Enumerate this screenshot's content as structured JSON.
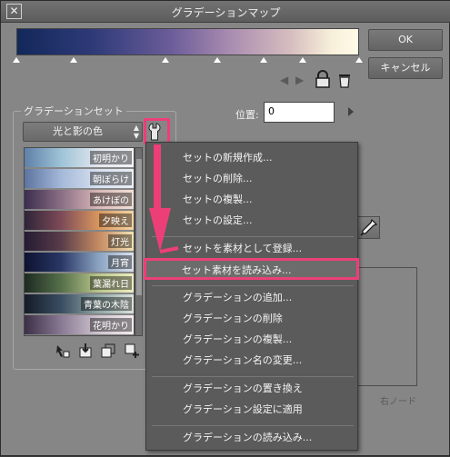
{
  "dialog": {
    "title": "グラデーションマップ",
    "close_label": "✕"
  },
  "buttons": {
    "ok": "OK",
    "cancel": "キャンセル"
  },
  "gradient_set": {
    "group_label": "グラデーションセット",
    "selected": "光と影の色",
    "items": [
      {
        "label": "初明かり",
        "colors": [
          "#5f80a8",
          "#9fc4d8",
          "#e2e6ee",
          "#f4f4f8"
        ]
      },
      {
        "label": "朝ぼらけ",
        "colors": [
          "#5c74a0",
          "#a5b9da",
          "#d6e0ee",
          "#ecf0f6"
        ]
      },
      {
        "label": "あけぼの",
        "colors": [
          "#3b2e4e",
          "#8b6f86",
          "#d9b7b7",
          "#f2e2d8"
        ]
      },
      {
        "label": "夕映え",
        "colors": [
          "#2e2438",
          "#7e4b58",
          "#d8965e",
          "#f6d8a8"
        ]
      },
      {
        "label": "灯光",
        "colors": [
          "#241a33",
          "#5a3d4a",
          "#c48a62",
          "#f6e6b8"
        ]
      },
      {
        "label": "月宵",
        "colors": [
          "#0d1230",
          "#2a3866",
          "#8aa2c0",
          "#dfe6f0"
        ]
      },
      {
        "label": "葉漏れ日",
        "colors": [
          "#1d2a22",
          "#56704a",
          "#b8c58a",
          "#f1f0c6"
        ]
      },
      {
        "label": "青葉の木陰",
        "colors": [
          "#141b26",
          "#3a4e62",
          "#8fa6a6",
          "#dfe6df"
        ]
      },
      {
        "label": "花明かり",
        "colors": [
          "#3b2f45",
          "#8a7a94",
          "#cfc4cf",
          "#f5eef2"
        ]
      }
    ]
  },
  "position": {
    "label": "位置:",
    "value": "0"
  },
  "right_node_label": "右ノード",
  "context_menu": {
    "items": [
      {
        "label": "セットの新規作成..."
      },
      {
        "label": "セットの削除..."
      },
      {
        "label": "セットの複製..."
      },
      {
        "label": "セットの設定..."
      },
      {
        "separator": true
      },
      {
        "label": "セットを素材として登録..."
      },
      {
        "label": "セット素材を読み込み...",
        "highlighted": true
      },
      {
        "separator": true
      },
      {
        "label": "グラデーションの追加..."
      },
      {
        "label": "グラデーションの削除"
      },
      {
        "label": "グラデーションの複製..."
      },
      {
        "label": "グラデーション名の変更..."
      },
      {
        "separator": true
      },
      {
        "label": "グラデーションの置き換え"
      },
      {
        "label": "グラデーション設定に適用"
      },
      {
        "separator": true
      },
      {
        "label": "グラデーションの読み込み..."
      }
    ]
  },
  "colors": {
    "highlight": "#ec3f78",
    "menu_bg": "#5b5b5b",
    "dialog_bg": "#868686"
  },
  "icons": [
    "close-icon",
    "prev-arrow-icon",
    "next-arrow-icon",
    "lock-icon",
    "trash-icon",
    "wrench-icon",
    "updown-icon",
    "eyedropper-icon",
    "new-gradient-icon",
    "import-icon",
    "duplicate-icon",
    "add-icon"
  ]
}
